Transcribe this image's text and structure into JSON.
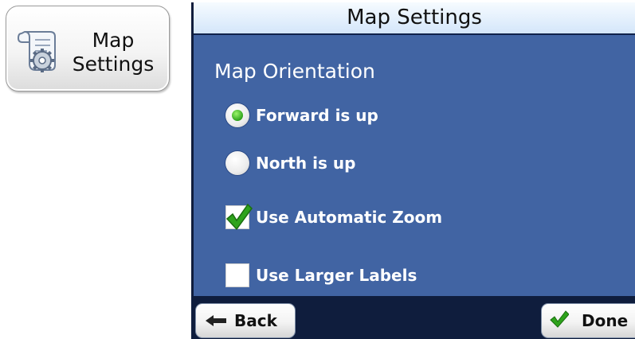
{
  "launcher": {
    "icon": "scroll-gear-icon",
    "label_line1": "Map",
    "label_line2": "Settings"
  },
  "panel": {
    "title": "Map Settings",
    "section_heading": "Map Orientation",
    "orientation_options": [
      {
        "label": "Forward is up",
        "selected": true
      },
      {
        "label": "North is up",
        "selected": false
      }
    ],
    "checkboxes": [
      {
        "label": "Use Automatic Zoom",
        "checked": true
      },
      {
        "label": "Use Larger Labels",
        "checked": false
      }
    ]
  },
  "footer": {
    "back_label": "Back",
    "back_icon": "left-arrow-icon",
    "done_label": "Done",
    "done_icon": "checkmark-icon"
  },
  "colors": {
    "panel_bg": "#4164a3",
    "title_bg": "#dbe9fb",
    "bottom_bar": "#0f1d3d",
    "accent_green": "#2ea31c"
  }
}
